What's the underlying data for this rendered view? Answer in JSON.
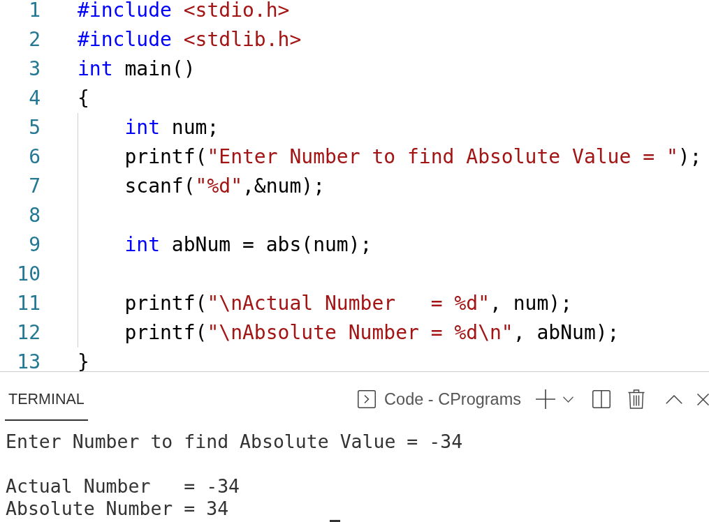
{
  "editor": {
    "lines": [
      {
        "kind": "line",
        "number": "1",
        "tokens": [
          {
            "kind": "keyword",
            "text": "#include"
          },
          {
            "kind": "string",
            "text": " <stdio.h>"
          }
        ]
      },
      {
        "kind": "line",
        "number": "2",
        "tokens": [
          {
            "kind": "keyword",
            "text": "#include"
          },
          {
            "kind": "string",
            "text": " <stdlib.h>"
          }
        ]
      },
      {
        "kind": "line",
        "number": "3",
        "tokens": [
          {
            "kind": "keyword",
            "text": "int"
          },
          {
            "kind": "plain",
            "text": " main()"
          }
        ]
      },
      {
        "kind": "line",
        "number": "4",
        "tokens": [
          {
            "kind": "plain",
            "text": "{"
          }
        ]
      },
      {
        "kind": "block",
        "children": [
          {
            "kind": "line",
            "number": "5",
            "tokens": [
              {
                "kind": "keyword",
                "text": "int"
              },
              {
                "kind": "plain",
                "text": " num;"
              }
            ]
          },
          {
            "kind": "line",
            "number": "6",
            "tokens": [
              {
                "kind": "plain",
                "text": "printf("
              },
              {
                "kind": "string",
                "text": "\"Enter Number to find Absolute Value = \""
              },
              {
                "kind": "plain",
                "text": ");"
              }
            ]
          },
          {
            "kind": "line",
            "number": "7",
            "tokens": [
              {
                "kind": "plain",
                "text": "scanf("
              },
              {
                "kind": "string",
                "text": "\"%d\""
              },
              {
                "kind": "plain",
                "text": ",&num);"
              }
            ]
          },
          {
            "kind": "line",
            "number": "8"
          },
          {
            "kind": "line",
            "number": "9",
            "tokens": [
              {
                "kind": "keyword",
                "text": "int"
              },
              {
                "kind": "plain",
                "text": " abNum = abs(num);"
              }
            ]
          },
          {
            "kind": "line",
            "number": "10"
          },
          {
            "kind": "line",
            "number": "11",
            "tokens": [
              {
                "kind": "plain",
                "text": "printf("
              },
              {
                "kind": "string",
                "text": "\"\\nActual Number   = %d\""
              },
              {
                "kind": "plain",
                "text": ", num);"
              }
            ]
          },
          {
            "kind": "line",
            "number": "12",
            "tokens": [
              {
                "kind": "plain",
                "text": "printf("
              },
              {
                "kind": "string",
                "text": "\"\\nAbsolute Number = %d\\n\""
              },
              {
                "kind": "plain",
                "text": ", abNum);"
              }
            ]
          }
        ]
      },
      {
        "kind": "line",
        "number": "13",
        "tokens": [
          {
            "kind": "plain",
            "text": "}"
          }
        ]
      }
    ]
  },
  "terminal_panel": {
    "tabs": [
      {
        "label": "TERMINAL",
        "selected": true
      }
    ],
    "terminal_instance": {
      "label": "Code - CPrograms"
    },
    "output": [
      {
        "lines": [
          "Enter Number to find Absolute Value = -34"
        ]
      },
      {
        "lines": [
          "Actual Number   = -34",
          "Absolute Number = 34"
        ]
      }
    ]
  }
}
